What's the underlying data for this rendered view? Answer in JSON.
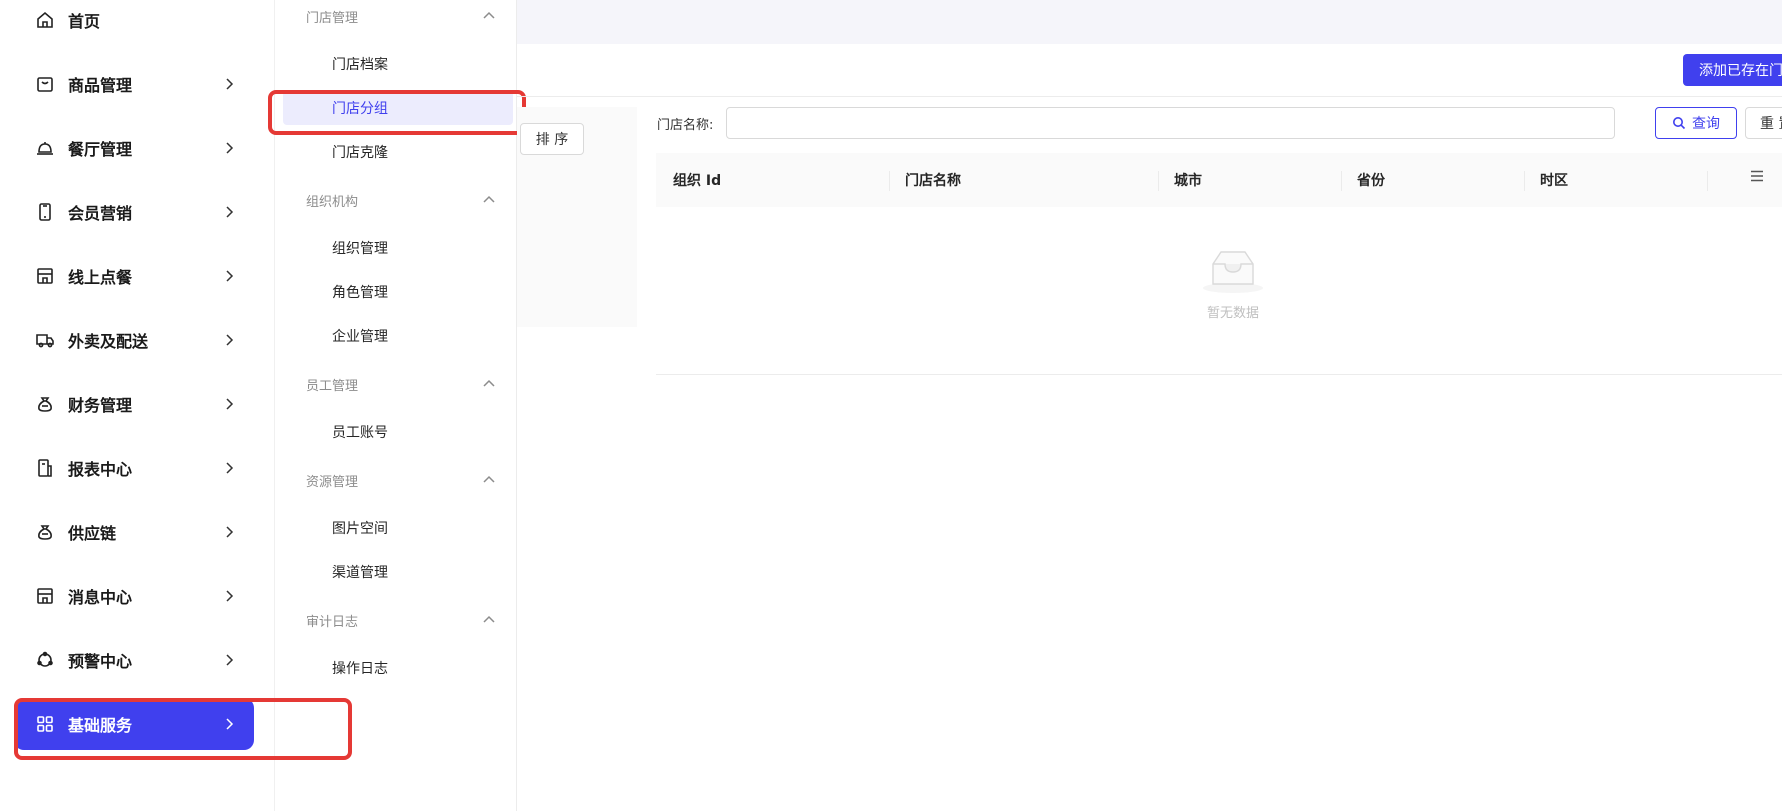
{
  "sidebar": {
    "items": [
      {
        "label": "首页",
        "icon": "home-icon"
      },
      {
        "label": "商品管理",
        "icon": "bag-icon"
      },
      {
        "label": "餐厅管理",
        "icon": "bell-icon"
      },
      {
        "label": "会员营销",
        "icon": "phone-icon"
      },
      {
        "label": "线上点餐",
        "icon": "store-icon"
      },
      {
        "label": "外卖及配送",
        "icon": "truck-icon"
      },
      {
        "label": "财务管理",
        "icon": "money-bag-icon"
      },
      {
        "label": "报表中心",
        "icon": "report-icon"
      },
      {
        "label": "供应链",
        "icon": "supply-icon"
      },
      {
        "label": "消息中心",
        "icon": "message-icon"
      },
      {
        "label": "预警中心",
        "icon": "alert-icon"
      },
      {
        "label": "基础服务",
        "icon": "grid-icon",
        "active": true
      }
    ]
  },
  "submenu": {
    "groups": [
      {
        "title": "门店管理",
        "items": [
          "门店档案",
          "门店分组",
          "门店克隆"
        ]
      },
      {
        "title": "组织机构",
        "items": [
          "组织管理",
          "角色管理",
          "企业管理"
        ]
      },
      {
        "title": "员工管理",
        "items": [
          "员工账号"
        ]
      },
      {
        "title": "资源管理",
        "items": [
          "图片空间",
          "渠道管理"
        ]
      },
      {
        "title": "审计日志",
        "items": [
          "操作日志"
        ]
      }
    ],
    "active_item": "门店分组"
  },
  "toolbar": {
    "add_button": "添加已存在门",
    "sort_button": "排 序"
  },
  "search": {
    "label": "门店名称:",
    "value": "",
    "placeholder": "",
    "query_button": "查询",
    "reset_button": "重 置"
  },
  "table": {
    "columns": [
      "组织 Id",
      "门店名称",
      "城市",
      "省份",
      "时区"
    ],
    "empty_text": "暂无数据"
  },
  "colors": {
    "primary": "#4040ee",
    "highlight_border": "#e53935"
  }
}
